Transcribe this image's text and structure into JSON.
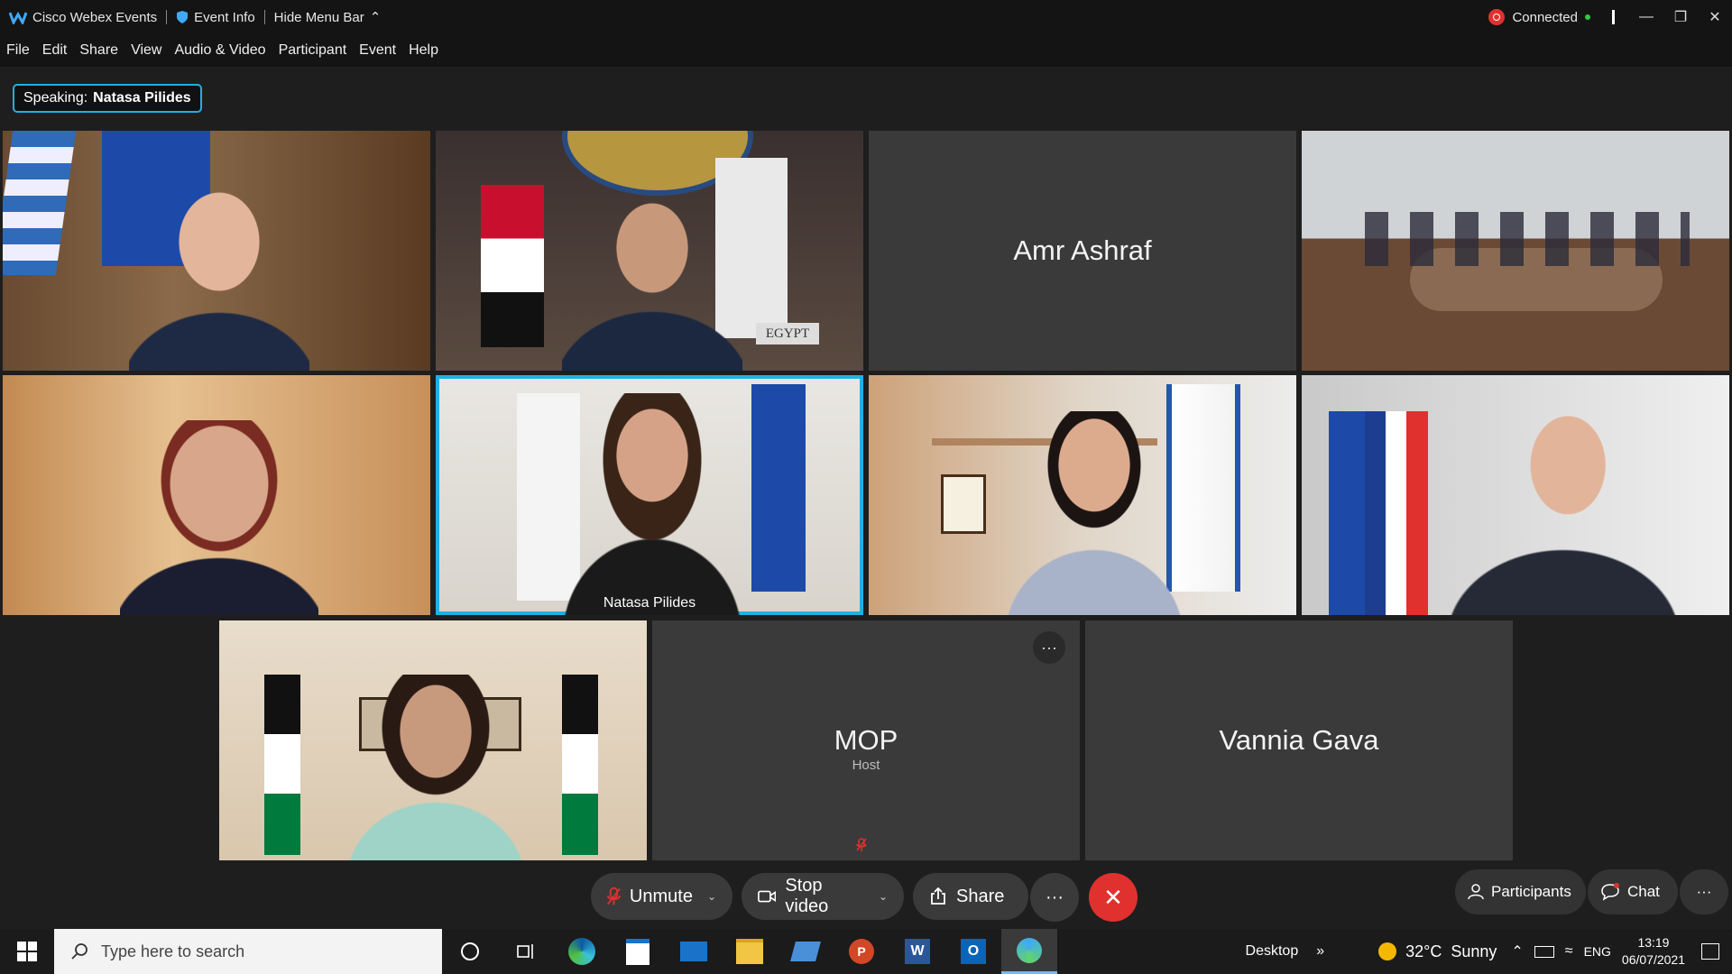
{
  "titlebar": {
    "app_name": "Cisco Webex Events",
    "event_info": "Event Info",
    "hide_menu": "Hide Menu Bar",
    "status": "Connected"
  },
  "menu": [
    "File",
    "Edit",
    "Share",
    "View",
    "Audio & Video",
    "Participant",
    "Event",
    "Help"
  ],
  "speaking": {
    "label": "Speaking:",
    "name": "Natasa Pilides"
  },
  "tiles": {
    "amr": {
      "name": "Amr Ashraf"
    },
    "natasa": {
      "name": "Natasa Pilides"
    },
    "mop": {
      "name": "MOP",
      "role": "Host"
    },
    "vannia": {
      "name": "Vannia Gava"
    }
  },
  "tile_labels": {
    "egypt_sign": "EGYPT"
  },
  "controls": {
    "unmute": "Unmute",
    "stop_video": "Stop video",
    "share": "Share",
    "participants": "Participants",
    "chat": "Chat"
  },
  "taskbar": {
    "search_placeholder": "Type here to search",
    "desktop": "Desktop",
    "weather": "32°C  Sunny",
    "lang": "ENG",
    "time": "13:19",
    "date": "06/07/2021"
  },
  "colors": {
    "accent": "#1fb1e3",
    "end_call": "#e0312e",
    "mute_red": "#e0312e"
  }
}
